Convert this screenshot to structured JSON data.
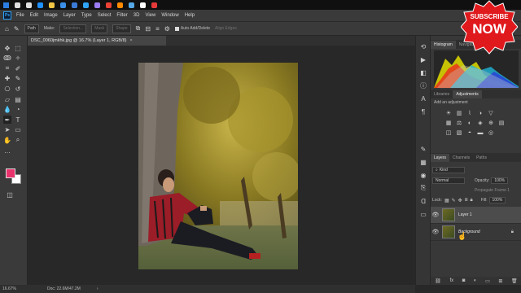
{
  "taskbar": {
    "apps": [
      {
        "icon": "windows-start-icon",
        "color": "#2b7de0"
      },
      {
        "icon": "search-icon",
        "color": "#e0e0e0"
      },
      {
        "icon": "task-view-icon",
        "color": "#e0e0e0"
      },
      {
        "icon": "edge-icon",
        "color": "#1e90ff"
      },
      {
        "icon": "file-explorer-icon",
        "color": "#f2c744"
      },
      {
        "icon": "store-icon",
        "color": "#3a8ee6"
      },
      {
        "icon": "app-icon",
        "color": "#3b7bd8"
      },
      {
        "icon": "photoshop-icon",
        "color": "#2fa3f6"
      },
      {
        "icon": "premiere-icon",
        "color": "#9b7cf2"
      },
      {
        "icon": "chrome-icon",
        "color": "#e94235"
      },
      {
        "icon": "media-icon",
        "color": "#ff8a00"
      },
      {
        "icon": "lightroom-icon",
        "color": "#56a9e8"
      },
      {
        "icon": "app-icon-2",
        "color": "#ffffff"
      },
      {
        "icon": "app-icon-3",
        "color": "#e63a3a"
      }
    ]
  },
  "menubar": {
    "logo": "Ps",
    "items": [
      "File",
      "Edit",
      "Image",
      "Layer",
      "Type",
      "Select",
      "Filter",
      "3D",
      "View",
      "Window",
      "Help"
    ]
  },
  "options": {
    "path_mode": "Path",
    "make": "Make:",
    "selection": "Selection...",
    "mask": "Mask",
    "shape": "Shape",
    "auto_add_delete": "Auto Add/Delete",
    "align_edges": "Align Edges"
  },
  "document": {
    "tab_title": "DSC_0060jmkhk.jpg @ 16.7% (Layer 1, RGB/8)",
    "close": "×"
  },
  "panels": {
    "histogram_tabs": [
      "Histogram",
      "Navigator"
    ],
    "adjust_tabs": [
      "Libraries",
      "Adjustments"
    ],
    "add_adjustment": "Add an adjustment",
    "layer_tabs": [
      "Layers",
      "Channels",
      "Paths"
    ],
    "kind": "Kind",
    "blend_mode": "Normal",
    "opacity_label": "Opacity:",
    "opacity_value": "100%",
    "lock_label": "Lock:",
    "fill_label": "Fill:",
    "fill_value": "100%",
    "propagate": "Propagate Frame 1",
    "layers": [
      {
        "name": "Layer 1",
        "selected": true,
        "italic": false,
        "locked": false
      },
      {
        "name": "Background",
        "selected": false,
        "italic": true,
        "locked": true
      }
    ]
  },
  "status": {
    "zoom": "16.67%",
    "doc": "Doc: 22.6M/47.2M"
  },
  "overlay": {
    "subscribe": "SUBSCRIBE",
    "now": "NOW",
    "color": "#e0191d"
  },
  "colors": {
    "foreground": "#e8336d",
    "background": "#ffffff"
  }
}
